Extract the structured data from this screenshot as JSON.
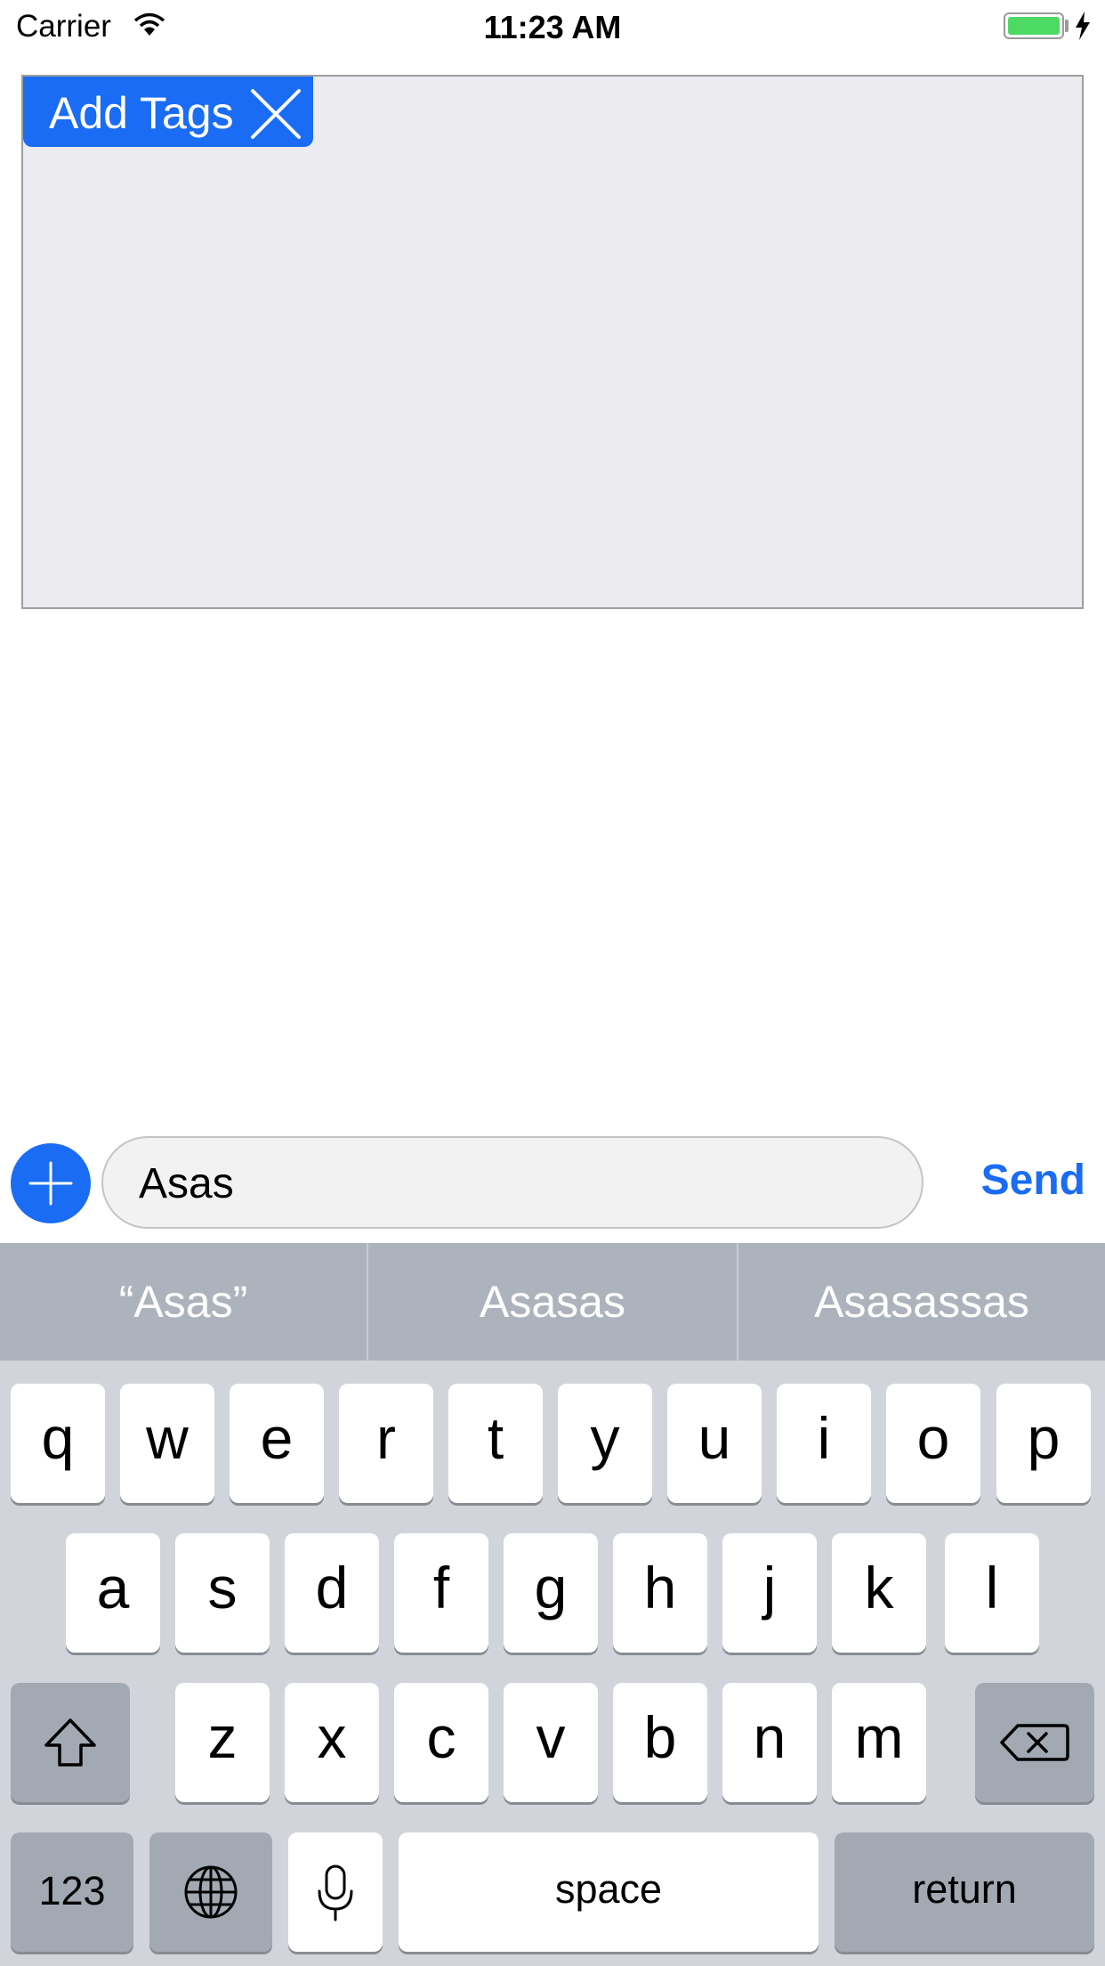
{
  "status_bar": {
    "carrier": "Carrier",
    "time": "11:23 AM",
    "battery_color": "#4cd964"
  },
  "tags": {
    "chip_label": "Add Tags",
    "chip_color": "#1a6cf5",
    "remove_icon": "close-icon"
  },
  "composer": {
    "add_icon": "plus-icon",
    "input_value": "Asas",
    "send_label": "Send",
    "accent": "#1a6cf5"
  },
  "keyboard": {
    "suggestions": [
      "“Asas”",
      "Asasas",
      "Asasassas"
    ],
    "row1": [
      "q",
      "w",
      "e",
      "r",
      "t",
      "y",
      "u",
      "i",
      "o",
      "p"
    ],
    "row2": [
      "a",
      "s",
      "d",
      "f",
      "g",
      "h",
      "j",
      "k",
      "l"
    ],
    "row3": [
      "z",
      "x",
      "c",
      "v",
      "b",
      "n",
      "m"
    ],
    "shift_icon": "shift-icon",
    "delete_icon": "delete-icon",
    "numbers_label": "123",
    "globe_icon": "globe-icon",
    "mic_icon": "microphone-icon",
    "space_label": "space",
    "return_label": "return"
  }
}
